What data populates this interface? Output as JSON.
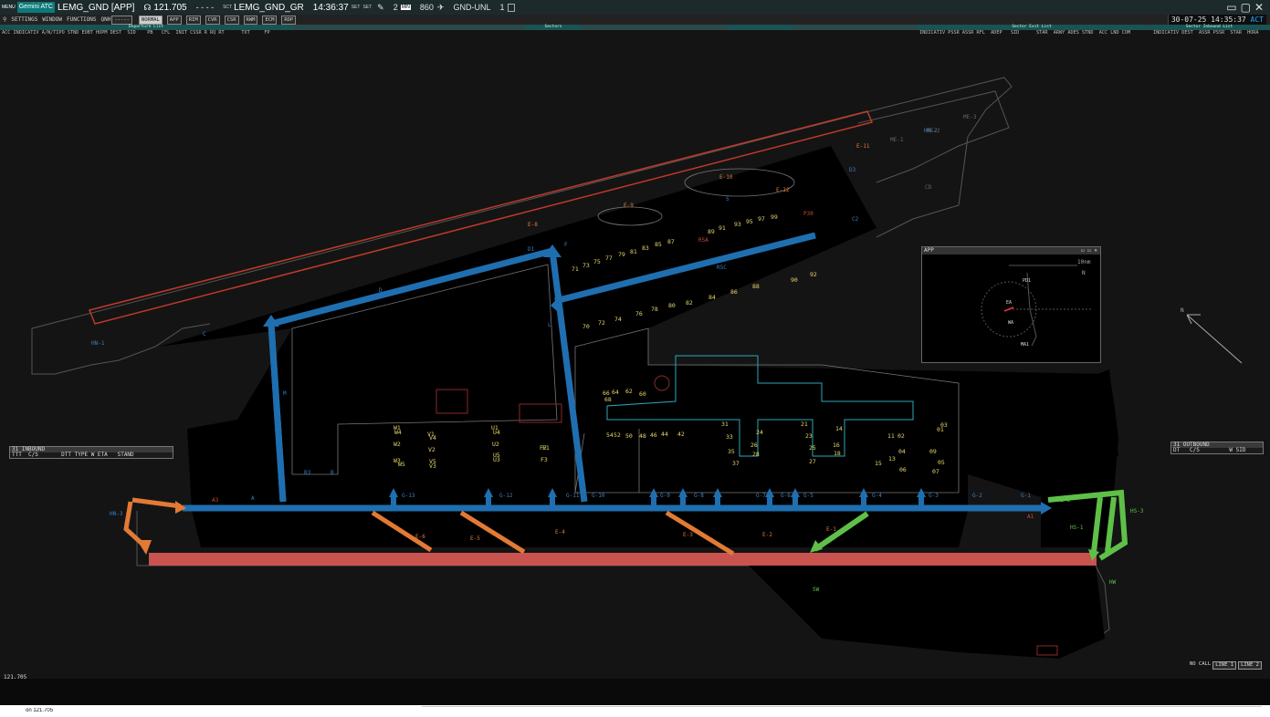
{
  "topbar": {
    "menu_icon": "MENU",
    "logo": "Gemini ATC",
    "position": "LEMG_GND [APP]",
    "freq_icon": "headset-icon",
    "frequency": "121.705",
    "dashes": "-  -  -  -",
    "sct_label": "SCT",
    "sct_value": "LEMG_GND_GR",
    "clock": "14:36:37",
    "set1": "SET",
    "set2": "SET",
    "counter_min": "2",
    "min_label": "MIN",
    "alt_value": "860",
    "range_label": "GND-UNL",
    "layers_value": "1"
  },
  "menubar": {
    "items": [
      "SETTINGS",
      "WINDOW",
      "FUNCTIONS"
    ],
    "qnh_label": "QNH",
    "qnh_value": "-----",
    "mode": "NORMAL",
    "buttons": [
      "APP",
      "RIM",
      "CVR",
      "CSR",
      "RWM",
      "ECM",
      "RDP"
    ],
    "datetime": "30-07-25 14:35:37",
    "active": "ACT"
  },
  "lists": {
    "departure_title": "Departure List",
    "sectors_title": "Sectors",
    "sector_exit_title": "Sector Exit List",
    "sector_inbound_title": "Sector Inbound List",
    "departure_cols": "ACC INDICATIV A/N/TIPO STND EOBT HOPM DEST  SID    PB   CFL  INIT CSSR R RQ RT      TXT     FP",
    "exit_cols": "INDICATIV PSSR ASSR RFL  ADEP   SID      STAR  ARWY ADES STND  ACC LND COM",
    "inbound_cols": "INDICATIV DEST  ASSR PSSR  STAR  HORA"
  },
  "inbound_panel": {
    "title": "31 INBOUND",
    "cols": "TTT  C/S       DTT TYPE W ETA   STAND"
  },
  "outbound_panel": {
    "title": "31 OUTBOUND",
    "cols": "DT   C/S         W SID"
  },
  "app_panel": {
    "title": "APP",
    "range": "10nm",
    "north": "N",
    "fixes": [
      "PD1",
      "EA",
      "WA",
      "MA1"
    ]
  },
  "taxiway_labels": [
    "D",
    "C",
    "D1",
    "L",
    "M",
    "E-8",
    "E-9",
    "E-10",
    "E-11",
    "E-12",
    "F",
    "D3",
    "C2",
    "B",
    "S",
    "A",
    "A1",
    "A3",
    "B3",
    "E-6",
    "E-5",
    "E-4",
    "E-3",
    "E-2",
    "E-1",
    "G-13",
    "G-12",
    "G-11",
    "G-10",
    "G-9",
    "G-8",
    "G-7",
    "G-6",
    "G-5",
    "G-4",
    "G-3",
    "G-2",
    "G-1",
    "HN-1",
    "HN-2",
    "HN-3",
    "HS-1",
    "HS-2",
    "HS-3",
    "ME-1",
    "ME-2",
    "ME-3",
    "R5A",
    "R5C",
    "P30",
    "CD",
    "HW",
    "SW"
  ],
  "stands": [
    "71",
    "73",
    "75",
    "77",
    "79",
    "81",
    "83",
    "85",
    "87",
    "89",
    "91",
    "93",
    "95",
    "97",
    "99",
    "70",
    "72",
    "74",
    "76",
    "78",
    "80",
    "82",
    "84",
    "86",
    "88",
    "90",
    "92",
    "66",
    "64",
    "62",
    "60",
    "68",
    "54",
    "52",
    "50",
    "48",
    "46",
    "44",
    "42",
    "31",
    "33",
    "35",
    "37",
    "24",
    "26",
    "28",
    "21",
    "23",
    "25",
    "27",
    "14",
    "16",
    "18",
    "11",
    "13",
    "15",
    "01",
    "02",
    "03",
    "04",
    "05",
    "06",
    "07",
    "09",
    "W1",
    "W2",
    "W3",
    "W4",
    "W5",
    "V1",
    "V2",
    "V3",
    "V4",
    "V5",
    "U1",
    "U2",
    "U3",
    "U4",
    "U5",
    "F1",
    "F2",
    "F3"
  ],
  "status": {
    "frequency": "121.705",
    "nocall": "NO CALL",
    "line1": "LINE 1",
    "line2": "LINE 2"
  },
  "cmdline": {
    "value": "on 121.705"
  },
  "colors": {
    "taxi_blue": "#1f6fb0",
    "runway_red": "#c8534f",
    "orange": "#e27a35",
    "green": "#5fc048",
    "background": "#141414",
    "fill_black": "#000000",
    "stand_yellow": "#e8d66a",
    "apron_cyan": "#2ba8b8"
  }
}
